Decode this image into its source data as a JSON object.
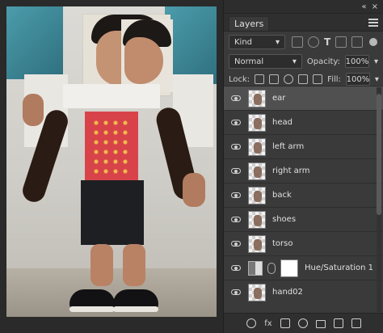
{
  "panel": {
    "tab_label": "Layers",
    "filter_label": "Kind",
    "blend_mode": "Normal",
    "opacity_label": "Opacity:",
    "opacity_value": "100%",
    "lock_label": "Lock:",
    "fill_label": "Fill:",
    "fill_value": "100%",
    "bottom_fx": "fx"
  },
  "layers": [
    {
      "name": "ear",
      "selected": true,
      "type": "pixel"
    },
    {
      "name": "head",
      "selected": false,
      "type": "pixel"
    },
    {
      "name": "left arm",
      "selected": false,
      "type": "pixel"
    },
    {
      "name": "right arm",
      "selected": false,
      "type": "pixel"
    },
    {
      "name": "back",
      "selected": false,
      "type": "pixel"
    },
    {
      "name": "shoes",
      "selected": false,
      "type": "pixel"
    },
    {
      "name": "torso",
      "selected": false,
      "type": "pixel"
    },
    {
      "name": "Hue/Saturation 1",
      "selected": false,
      "type": "adjustment"
    },
    {
      "name": "hand02",
      "selected": false,
      "type": "pixel"
    }
  ],
  "colors": {
    "panel_bg": "#3a3a3a",
    "selected_row": "#505050",
    "text": "#e0e0e0"
  },
  "icons": {
    "panel_menu": "hamburger-menu-icon",
    "visibility": "eye-icon",
    "filter_pixel": "image-filter-icon",
    "filter_adjustment": "circle-filter-icon",
    "filter_type": "type-filter-icon",
    "filter_shape": "shape-filter-icon",
    "filter_smart": "smart-object-filter-icon",
    "filter_toggle": "filter-toggle-icon",
    "lock_transparent": "lock-transparent-pixels-icon",
    "lock_image": "lock-image-pixels-icon",
    "lock_position": "lock-position-icon",
    "lock_artboard": "lock-artboard-icon",
    "lock_all": "lock-all-icon",
    "link": "link-layers-icon",
    "add_mask": "add-mask-icon",
    "new_fill_adjustment": "new-fill-adjustment-icon",
    "new_group": "new-group-icon",
    "new_layer": "new-layer-icon",
    "delete_layer": "trash-icon"
  }
}
